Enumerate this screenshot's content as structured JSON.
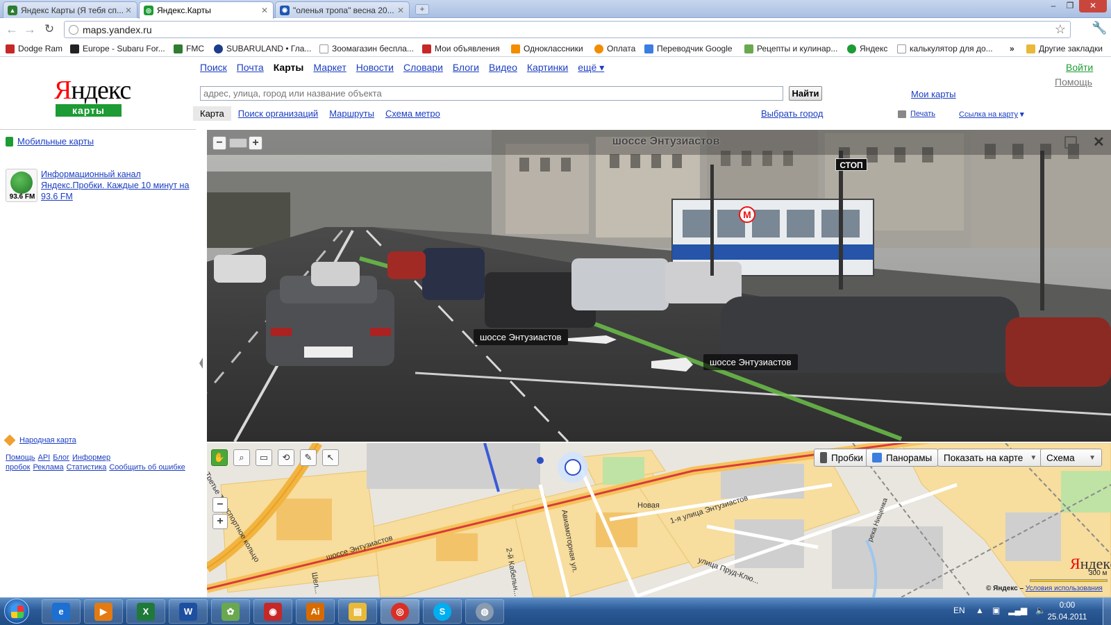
{
  "browser": {
    "tabs": [
      {
        "label": "Яндекс Карты (Я тебя сп...",
        "icon_color": "#2e7d32"
      },
      {
        "label": "Яндекс.Карты",
        "icon_color": "#1d9b34"
      },
      {
        "label": "\"оленья тропа\" весна 20...",
        "icon_color": "#1e57b4"
      }
    ],
    "url": "maps.yandex.ru",
    "bookmarks": [
      {
        "label": "Dodge Ram",
        "icon_color": "#c62828"
      },
      {
        "label": "Europe - Subaru For...",
        "icon_color": "#222222"
      },
      {
        "label": "FMC",
        "icon_color": "#2e7d32"
      },
      {
        "label": "SUBARULAND • Гла...",
        "icon_color": "#1e3c8c"
      },
      {
        "label": "Зоомагазин беспла...",
        "icon_color": "#999999"
      },
      {
        "label": "Мои объявления",
        "icon_color": "#c62828"
      },
      {
        "label": "Одноклассники",
        "icon_color": "#f28c00"
      },
      {
        "label": "Оплата",
        "icon_color": "#f28c00"
      },
      {
        "label": "Переводчик Google",
        "icon_color": "#3b7de0"
      },
      {
        "label": "Рецепты и кулинар...",
        "icon_color": "#6aa84f"
      },
      {
        "label": "Яндекс",
        "icon_color": "#1d9b34"
      },
      {
        "label": "калькулятор для до...",
        "icon_color": "#999999"
      }
    ],
    "bookmarks_more": "»",
    "other_bookmarks": "Другие закладки"
  },
  "yandex": {
    "logo_first": "Я",
    "logo_rest": "ндекс",
    "logo_sub": "карты",
    "services": [
      "Поиск",
      "Почта",
      "Карты",
      "Маркет",
      "Новости",
      "Словари",
      "Блоги",
      "Видео",
      "Картинки"
    ],
    "services_more": "ещё ▾",
    "login": "Войти",
    "help": "Помощь",
    "search_placeholder": "адрес, улица, город или название объекта",
    "search_button": "Найти",
    "my_maps": "Мои карты",
    "subnav": [
      "Карта",
      "Поиск организаций",
      "Маршруты",
      "Схема метро"
    ],
    "choose_city": "Выбрать город",
    "print": "Печать",
    "map_link": "Ссылка на карту",
    "map_link_caret": "▾"
  },
  "sidebar": {
    "mobile_maps": "Мобильные карты",
    "radio_badge": "93.6 FM",
    "radio_link": "Информационный канал Яндекс.Пробки. Каждые 10 минут на 93.6 FM",
    "narod_map": "Народная карта",
    "footer_links": [
      "Помощь",
      "API",
      "Блог",
      "Информер пробок",
      "Реклама",
      "Статистика",
      "Сообщить об ошибке"
    ]
  },
  "panorama": {
    "title": "шоссе Энтузиастов",
    "zoom_out": "−",
    "zoom_in": "+",
    "close": "✕",
    "street_labels": [
      "шоссе Энтузиастов",
      "шоссе Энтузиастов"
    ],
    "metro": "М",
    "stop_sign": "СТОП"
  },
  "map": {
    "tools": [
      "✋",
      "⌕",
      "▭",
      "⟲",
      "✎",
      "↖"
    ],
    "zoom_out": "−",
    "zoom_in": "+",
    "controls": {
      "traffic": "Пробки",
      "panoramas": "Панорамы",
      "show_on_map": "Показать на карте",
      "layer": "Схема"
    },
    "street_labels": [
      "Третье Транспортное кольцо",
      "шоссе Энтузиастов",
      "Авиамоторная ул.",
      "2-й Кабельн...",
      "Новая",
      "1-я улица Энтузиастов",
      "улица Пруд-Клю...",
      "река Нищенка",
      "Шел..."
    ],
    "logo_first": "Я",
    "logo_rest": "ндекс",
    "scale": "300 м",
    "copyright": "© Яндекс –",
    "terms": "Условия использования"
  },
  "taskbar": {
    "apps": [
      {
        "name": "ie",
        "color": "#1d6fd1",
        "glyph": "e"
      },
      {
        "name": "media",
        "color": "#e47a12",
        "glyph": "▶"
      },
      {
        "name": "excel",
        "color": "#1f7a3a",
        "glyph": "X"
      },
      {
        "name": "word",
        "color": "#1f4fa0",
        "glyph": "W"
      },
      {
        "name": "app-green",
        "color": "#6aa84f",
        "glyph": "✿"
      },
      {
        "name": "camera",
        "color": "#c62828",
        "glyph": "◉"
      },
      {
        "name": "illustrator",
        "color": "#d76b00",
        "glyph": "Ai"
      },
      {
        "name": "explorer",
        "color": "#e8b93a",
        "glyph": "▤"
      },
      {
        "name": "chrome",
        "color": "#d93025",
        "glyph": "◎"
      },
      {
        "name": "skype",
        "color": "#00aff0",
        "glyph": "S"
      },
      {
        "name": "webcam",
        "color": "#8a9bb0",
        "glyph": "◍"
      }
    ],
    "lang": "EN",
    "time": "0:00",
    "date": "25.04.2011"
  }
}
